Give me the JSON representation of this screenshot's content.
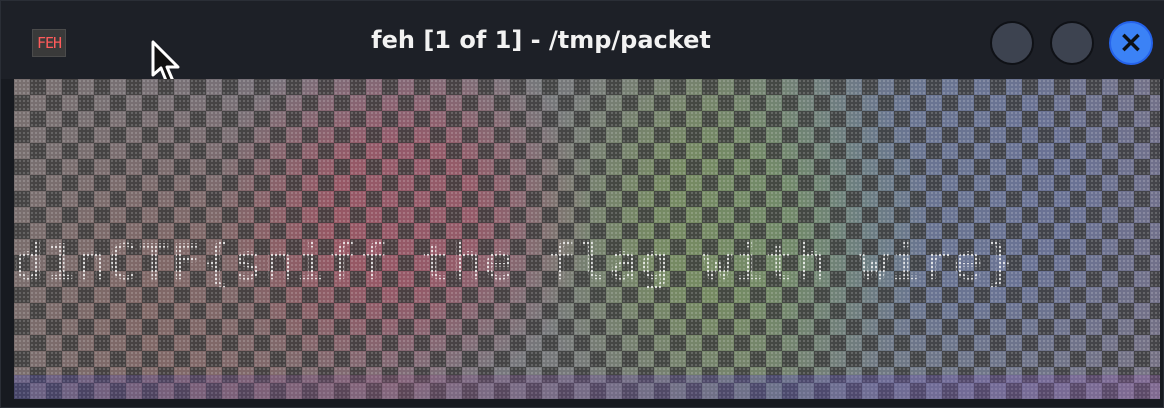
{
  "window": {
    "title": "feh [1 of 1] - /tmp/packet",
    "app_icon_label": "FEH",
    "controls": {
      "minimize_icon": "circle-button",
      "maximize_icon": "circle-button",
      "close_icon": "close-icon",
      "close_label": "×",
      "close_accent": "#3b82f6"
    },
    "cursor_icon": "mouse-pointer-icon"
  },
  "viewer": {
    "image_text": "d1nCTF{sniff_the_flag_with_wire}",
    "background_style": "transparent checkerboard"
  }
}
